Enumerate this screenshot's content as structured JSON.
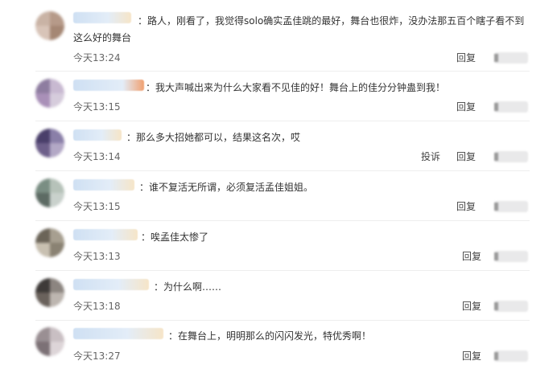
{
  "comments": [
    {
      "text": "路人，刚看了，我觉得solo确实孟佳跳的最好，舞台也很炸，没办法那五百个瞎子看不到这么好的舞台",
      "time": "今天13:24",
      "reply": "回复"
    },
    {
      "text": "我大声喊出来为什么大家看不见佳的好！舞台上的佳分分钟蛊到我！",
      "time": "今天13:15",
      "reply": "回复"
    },
    {
      "text": "那么多大招她都可以，结果这名次，哎",
      "time": "今天13:14",
      "report": "投诉",
      "reply": "回复"
    },
    {
      "text": "谁不复活无所谓，必须复活孟佳姐姐。",
      "time": "今天13:15",
      "reply": "回复"
    },
    {
      "text": "唉孟佳太惨了",
      "time": "今天13:13",
      "reply": "回复"
    },
    {
      "text": "为什么啊……",
      "time": "今天13:18",
      "reply": "回复"
    },
    {
      "text": "在舞台上，明明那么的闪闪发光，特优秀啊！",
      "time": "今天13:27",
      "reply": "回复"
    }
  ],
  "colors": {
    "text": "#333333",
    "time": "#666666",
    "action": "#444444"
  }
}
